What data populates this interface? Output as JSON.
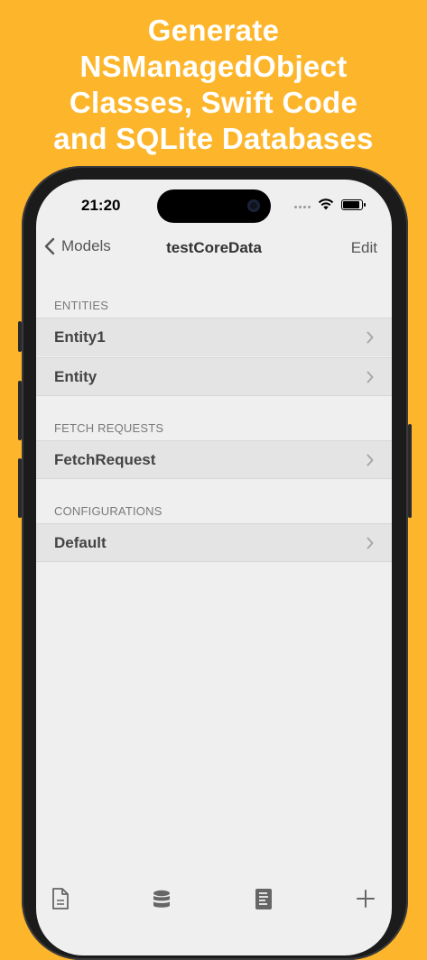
{
  "headline": {
    "lines": [
      "Generate",
      "NSManagedObject",
      "Classes, Swift Code",
      "and SQLite Databases"
    ]
  },
  "status_bar": {
    "time": "21:20"
  },
  "nav": {
    "back_label": "Models",
    "title": "testCoreData",
    "edit_label": "Edit"
  },
  "sections": [
    {
      "header": "ENTITIES",
      "items": [
        {
          "label": "Entity1"
        },
        {
          "label": "Entity"
        }
      ]
    },
    {
      "header": "FETCH REQUESTS",
      "items": [
        {
          "label": "FetchRequest"
        }
      ]
    },
    {
      "header": "CONFIGURATIONS",
      "items": [
        {
          "label": "Default"
        }
      ]
    }
  ],
  "tabbar": {
    "icons": [
      "document-icon",
      "database-icon",
      "code-document-icon",
      "plus-icon"
    ]
  },
  "colors": {
    "background": "#FDB62B",
    "screen": "#efefef",
    "row": "#e4e4e4"
  }
}
